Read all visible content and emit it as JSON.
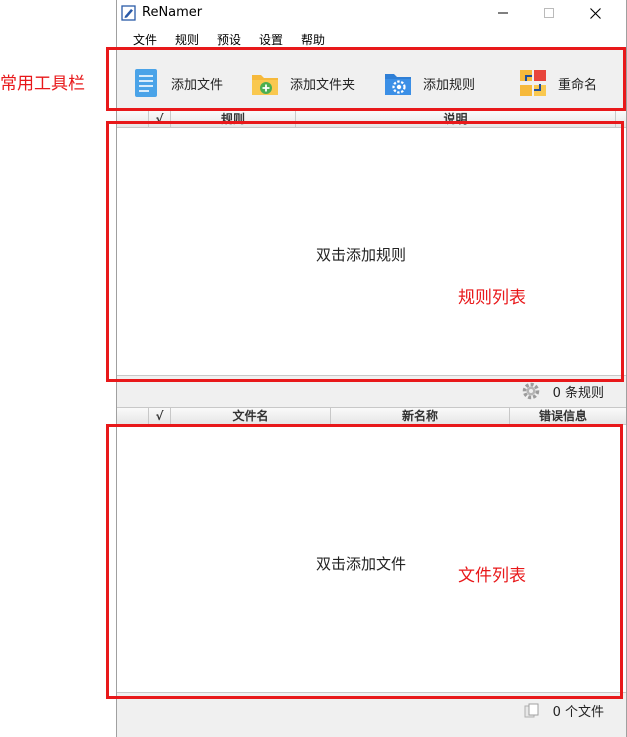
{
  "window": {
    "title": "ReNamer"
  },
  "menu": [
    "文件",
    "规则",
    "预设",
    "设置",
    "帮助"
  ],
  "toolbar": {
    "add_file": "添加文件",
    "add_folder": "添加文件夹",
    "add_rule": "添加规则",
    "rename": "重命名"
  },
  "rules_table": {
    "columns": [
      "√",
      "规则",
      "说明"
    ],
    "empty_hint": "双击添加规则",
    "count_label": "0 条规则"
  },
  "files_table": {
    "columns": [
      "√",
      "文件名",
      "新名称",
      "错误信息"
    ],
    "empty_hint": "双击添加文件",
    "count_label": "0 个文件"
  },
  "annotations": {
    "toolbar": "常用工具栏",
    "rules_list": "规则列表",
    "files_list": "文件列表",
    "color": "#e8181a"
  }
}
